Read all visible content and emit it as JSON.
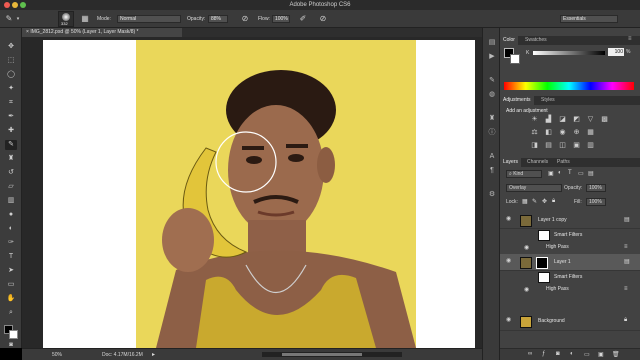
{
  "app": {
    "title": "Adobe Photoshop CS6",
    "workspace": "Essentials"
  },
  "options_bar": {
    "brush_size": "332",
    "mode_label": "Mode:",
    "mode_value": "Normal",
    "opacity_label": "Opacity:",
    "opacity_value": "88%",
    "flow_label": "Flow:",
    "flow_value": "100%"
  },
  "document": {
    "tab_title": "IMG_2812.psd @ 50% (Layer 1, Layer Mask/8) *"
  },
  "status_bar": {
    "zoom": "50%",
    "doc_info": "Doc: 4.17M/16.2M"
  },
  "color_panel": {
    "tabs": [
      "Color",
      "Swatches"
    ],
    "k_label": "K",
    "k_value": "100",
    "percent": "%"
  },
  "adjustments_panel": {
    "tabs": [
      "Adjustments",
      "Styles"
    ],
    "heading": "Add an adjustment"
  },
  "layers_panel": {
    "tabs": [
      "Layers",
      "Channels",
      "Paths"
    ],
    "filter_kind": "Kind",
    "blend_mode": "Overlay",
    "opacity_label": "Opacity:",
    "opacity_value": "100%",
    "lock_label": "Lock:",
    "fill_label": "Fill:",
    "fill_value": "100%",
    "layers": [
      {
        "name": "Layer 1 copy",
        "smart_filters": "Smart Filters",
        "filter": "High Pass"
      },
      {
        "name": "Layer 1",
        "smart_filters": "Smart Filters",
        "filter": "High Pass"
      },
      {
        "name": "Background"
      }
    ]
  },
  "colors": {
    "accent": "#2a63b8",
    "photo_background": "#ead75a",
    "shirt": "#c9a92e"
  }
}
